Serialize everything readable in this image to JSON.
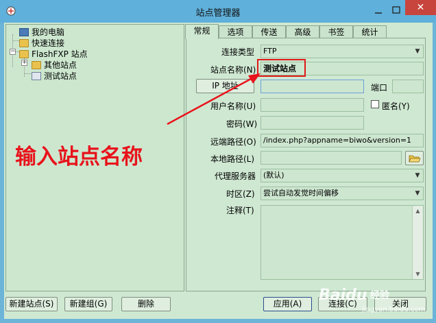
{
  "window": {
    "title": "站点管理器",
    "close_glyph": "✕",
    "min_glyph": "—",
    "max_glyph": "□"
  },
  "tree": {
    "items": [
      {
        "label": "我的电脑",
        "icon": "computer-icon"
      },
      {
        "label": "快速连接",
        "icon": "folder-icon"
      },
      {
        "label": "FlashFXP 站点",
        "icon": "folder-icon"
      },
      {
        "label": "其他站点",
        "icon": "folder-icon"
      },
      {
        "label": "测试站点",
        "icon": "site-computer-icon"
      }
    ],
    "expander_plus": "+",
    "expander_minus": "−"
  },
  "tabs": [
    "常规",
    "选项",
    "传送",
    "高级",
    "书签",
    "统计"
  ],
  "form": {
    "conn_type_label": "连接类型",
    "conn_type_value": "FTP",
    "site_name_label": "站点名称(N)",
    "site_name_value": "测试站点",
    "ip_button": "IP 地址",
    "ip_value": "",
    "port_label": "端口",
    "port_value": "",
    "username_label": "用户名称(U)",
    "username_value": "",
    "anonymous_label": "匿名(Y)",
    "password_label": "密码(W)",
    "password_value": "",
    "remote_path_label": "远端路径(O)",
    "remote_path_value": "/index.php?appname=biwo&version=1",
    "local_path_label": "本地路径(L)",
    "local_path_value": "",
    "proxy_label": "代理服务器",
    "proxy_value": "(默认)",
    "timezone_label": "时区(Z)",
    "timezone_value": "尝试自动发觉时间偏移",
    "notes_label": "注释(T)",
    "notes_value": ""
  },
  "buttons": {
    "new_site": "新建站点(S)",
    "new_group": "新建组(G)",
    "delete": "删除",
    "apply": "应用(A)",
    "connect": "连接(C)",
    "close": "关闭"
  },
  "annotation": {
    "text": "输入站点名称",
    "color": "#e8131b"
  },
  "watermark": {
    "brand": "Baidu",
    "sub": "经验",
    "url": "jingyan.baidu.com"
  },
  "colors": {
    "titlebar": "#5fb0da",
    "dialog_bg": "#cfe8d2",
    "close_red": "#c7453c",
    "highlight_red": "#e01818"
  }
}
